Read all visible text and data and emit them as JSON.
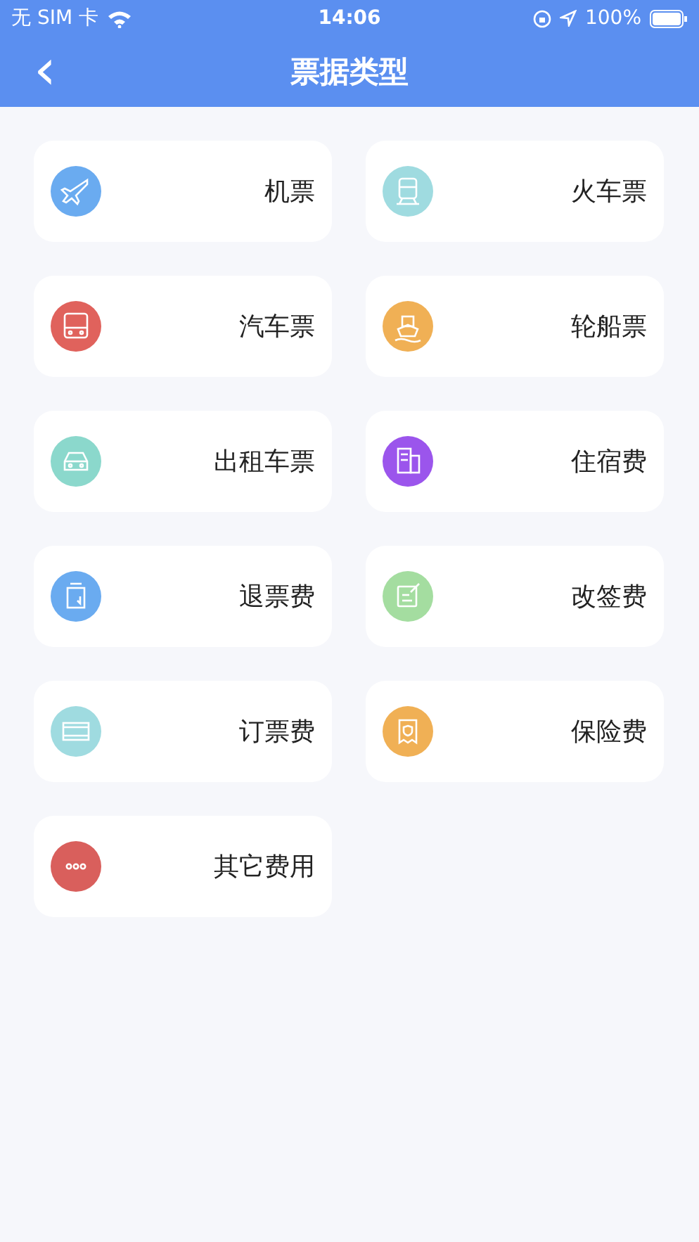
{
  "status_bar": {
    "carrier": "无 SIM 卡",
    "time": "14:06",
    "battery": "100%"
  },
  "nav": {
    "back": "‹",
    "title": "票据类型"
  },
  "items": [
    {
      "label": "机票",
      "kind": "plane",
      "color": "#6aabf0"
    },
    {
      "label": "火车票",
      "kind": "train",
      "color": "#9fdbe0"
    },
    {
      "label": "汽车票",
      "kind": "bus",
      "color": "#e0625c"
    },
    {
      "label": "轮船票",
      "kind": "ship",
      "color": "#f0b055"
    },
    {
      "label": "出租车票",
      "kind": "taxi",
      "color": "#8bd8cc"
    },
    {
      "label": "住宿费",
      "kind": "hotel",
      "color": "#9b55ec"
    },
    {
      "label": "退票费",
      "kind": "refund",
      "color": "#6aabf0"
    },
    {
      "label": "改签费",
      "kind": "change",
      "color": "#a4dda0"
    },
    {
      "label": "订票费",
      "kind": "booking",
      "color": "#9fdbe0"
    },
    {
      "label": "保险费",
      "kind": "insurance",
      "color": "#f0b055"
    },
    {
      "label": "其它费用",
      "kind": "more",
      "color": "#d95f5c"
    }
  ]
}
